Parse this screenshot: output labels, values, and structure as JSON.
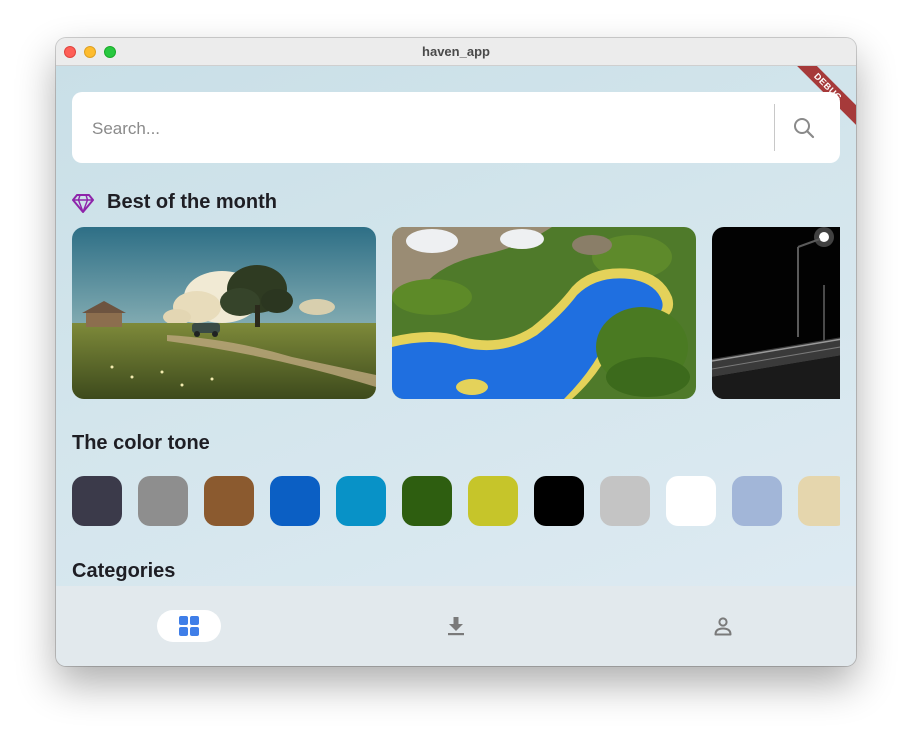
{
  "window": {
    "title": "haven_app"
  },
  "debug_banner": "DEBUG",
  "search": {
    "placeholder": "Search...",
    "icon": "search-icon"
  },
  "best_of_month": {
    "title": "Best of the month",
    "icon": "gem-icon",
    "wallpapers": [
      {
        "name": "countryside-tree-sunset"
      },
      {
        "name": "hexagon-island-river"
      },
      {
        "name": "night-highway-streetlights"
      }
    ]
  },
  "color_tone": {
    "title": "The color tone",
    "colors": [
      "#3b3a4a",
      "#8e8e8e",
      "#8b5a2f",
      "#0b5fc4",
      "#0892c7",
      "#2e5e10",
      "#c6c52a",
      "#000000",
      "#c4c4c4",
      "#ffffff",
      "#a2b6d8",
      "#e5d6ad"
    ]
  },
  "categories": {
    "title": "Categories"
  },
  "nav": {
    "items": [
      {
        "icon": "grid-icon",
        "active": true
      },
      {
        "icon": "download-icon",
        "active": false
      },
      {
        "icon": "profile-icon",
        "active": false
      }
    ],
    "accent": "#3f7ee8"
  }
}
